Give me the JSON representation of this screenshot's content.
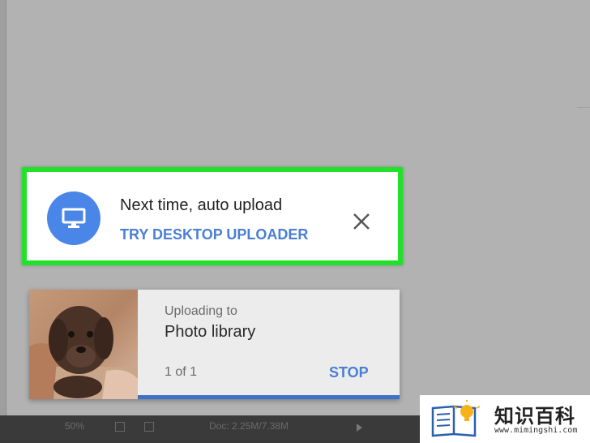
{
  "notification": {
    "icon": "desktop-monitor-icon",
    "title": "Next time, auto upload",
    "action_label": "TRY DESKTOP UPLOADER",
    "close_icon": "close-icon",
    "highlight_color": "#22e12a",
    "icon_bg_color": "#4a86e8",
    "action_color": "#4a7fd4"
  },
  "upload": {
    "status_label": "Uploading to",
    "destination": "Photo library",
    "count": "1 of 1",
    "stop_label": "STOP",
    "progress": 1.0,
    "progress_color": "#3e72c9"
  },
  "status_bar": {
    "zoom": "50%",
    "doc_info": "Doc: 2.25M/7.38M"
  },
  "watermark": {
    "text": "知识百科",
    "url": "www.mimingshi.com"
  }
}
